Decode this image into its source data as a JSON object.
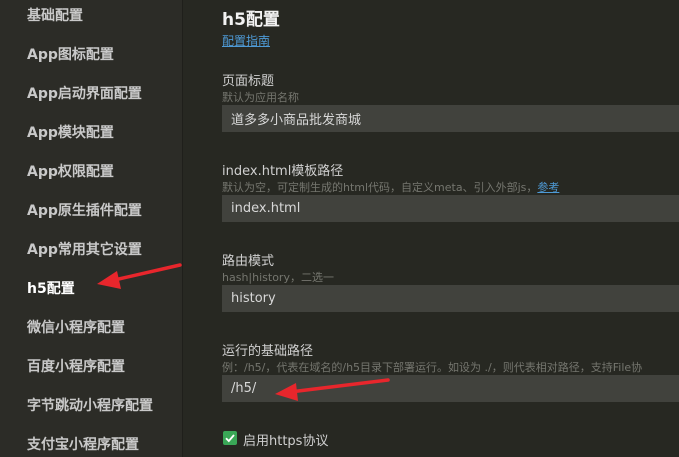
{
  "sidebar": {
    "items": [
      {
        "label": "基础配置"
      },
      {
        "label": "App图标配置"
      },
      {
        "label": "App启动界面配置"
      },
      {
        "label": "App模块配置"
      },
      {
        "label": "App权限配置"
      },
      {
        "label": "App原生插件配置"
      },
      {
        "label": "App常用其它设置"
      },
      {
        "label": "h5配置"
      },
      {
        "label": "微信小程序配置"
      },
      {
        "label": "百度小程序配置"
      },
      {
        "label": "字节跳动小程序配置"
      },
      {
        "label": "支付宝小程序配置"
      }
    ],
    "active_index": 7
  },
  "main": {
    "title": "h5配置",
    "guide_link": "配置指南",
    "fields": {
      "page_title": {
        "label": "页面标题",
        "hint": "默认为应用名称",
        "value": "道多多小商品批发商城"
      },
      "template_path": {
        "label": "index.html模板路径",
        "hint": "默认为空，可定制生成的html代码，自定义meta、引入外部js，",
        "hint_link": "参考",
        "value": "index.html"
      },
      "router_mode": {
        "label": "路由模式",
        "hint": "hash|history，二选一",
        "value": "history"
      },
      "base_path": {
        "label": "运行的基础路径",
        "hint": "例：/h5/，代表在域名的/h5目录下部署运行。如设为 ./，则代表相对路径，支持File协",
        "value": "/h5/"
      }
    },
    "https_checkbox": {
      "label": "启用https协议",
      "checked": true
    }
  },
  "annotation_color": "#e8262c"
}
